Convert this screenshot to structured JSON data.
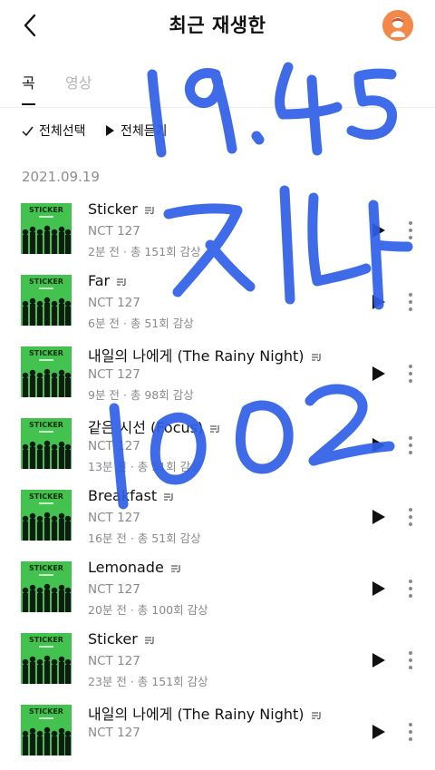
{
  "header": {
    "title": "최근 재생한",
    "back_icon": "chevron-left-icon",
    "avatar_icon": "person-avatar-icon"
  },
  "tabs": [
    {
      "label": "곡",
      "active": true
    },
    {
      "label": "영상",
      "active": false
    }
  ],
  "actions": {
    "select_all": "전체선택",
    "play_all": "전체듣기"
  },
  "date_header": "2021.09.19",
  "songs": [
    {
      "title": "Sticker",
      "artist": "NCT 127",
      "meta": "2분 전 · 총 151회 감상",
      "album_label": "STICKER"
    },
    {
      "title": "Far",
      "artist": "NCT 127",
      "meta": "6분 전 · 총 51회 감상",
      "album_label": "STICKER"
    },
    {
      "title": "내일의 나에게 (The Rainy Night)",
      "artist": "NCT 127",
      "meta": "9분 전 · 총 98회 감상",
      "album_label": "STICKER"
    },
    {
      "title": "같은 시선 (Focus)",
      "artist": "NCT 127",
      "meta": "13분 전 · 총 51회 감상",
      "album_label": "STICKER"
    },
    {
      "title": "Breakfast",
      "artist": "NCT 127",
      "meta": "16분 전 · 총 51회 감상",
      "album_label": "STICKER"
    },
    {
      "title": "Lemonade",
      "artist": "NCT 127",
      "meta": "20분 전 · 총 100회 감상",
      "album_label": "STICKER"
    },
    {
      "title": "Sticker",
      "artist": "NCT 127",
      "meta": "23분 전 · 총 151회 감상",
      "album_label": "STICKER"
    },
    {
      "title": "내일의 나에게 (The Rainy Night)",
      "artist": "NCT 127",
      "meta": "",
      "album_label": "STICKER"
    }
  ],
  "handwriting": {
    "lines": [
      "19.45",
      "지나",
      "1002"
    ],
    "color": "#2f5fe8"
  },
  "colors": {
    "album_green": "#43c24f",
    "avatar_orange": "#f2894a",
    "secondary_text": "#8a8a8a"
  }
}
